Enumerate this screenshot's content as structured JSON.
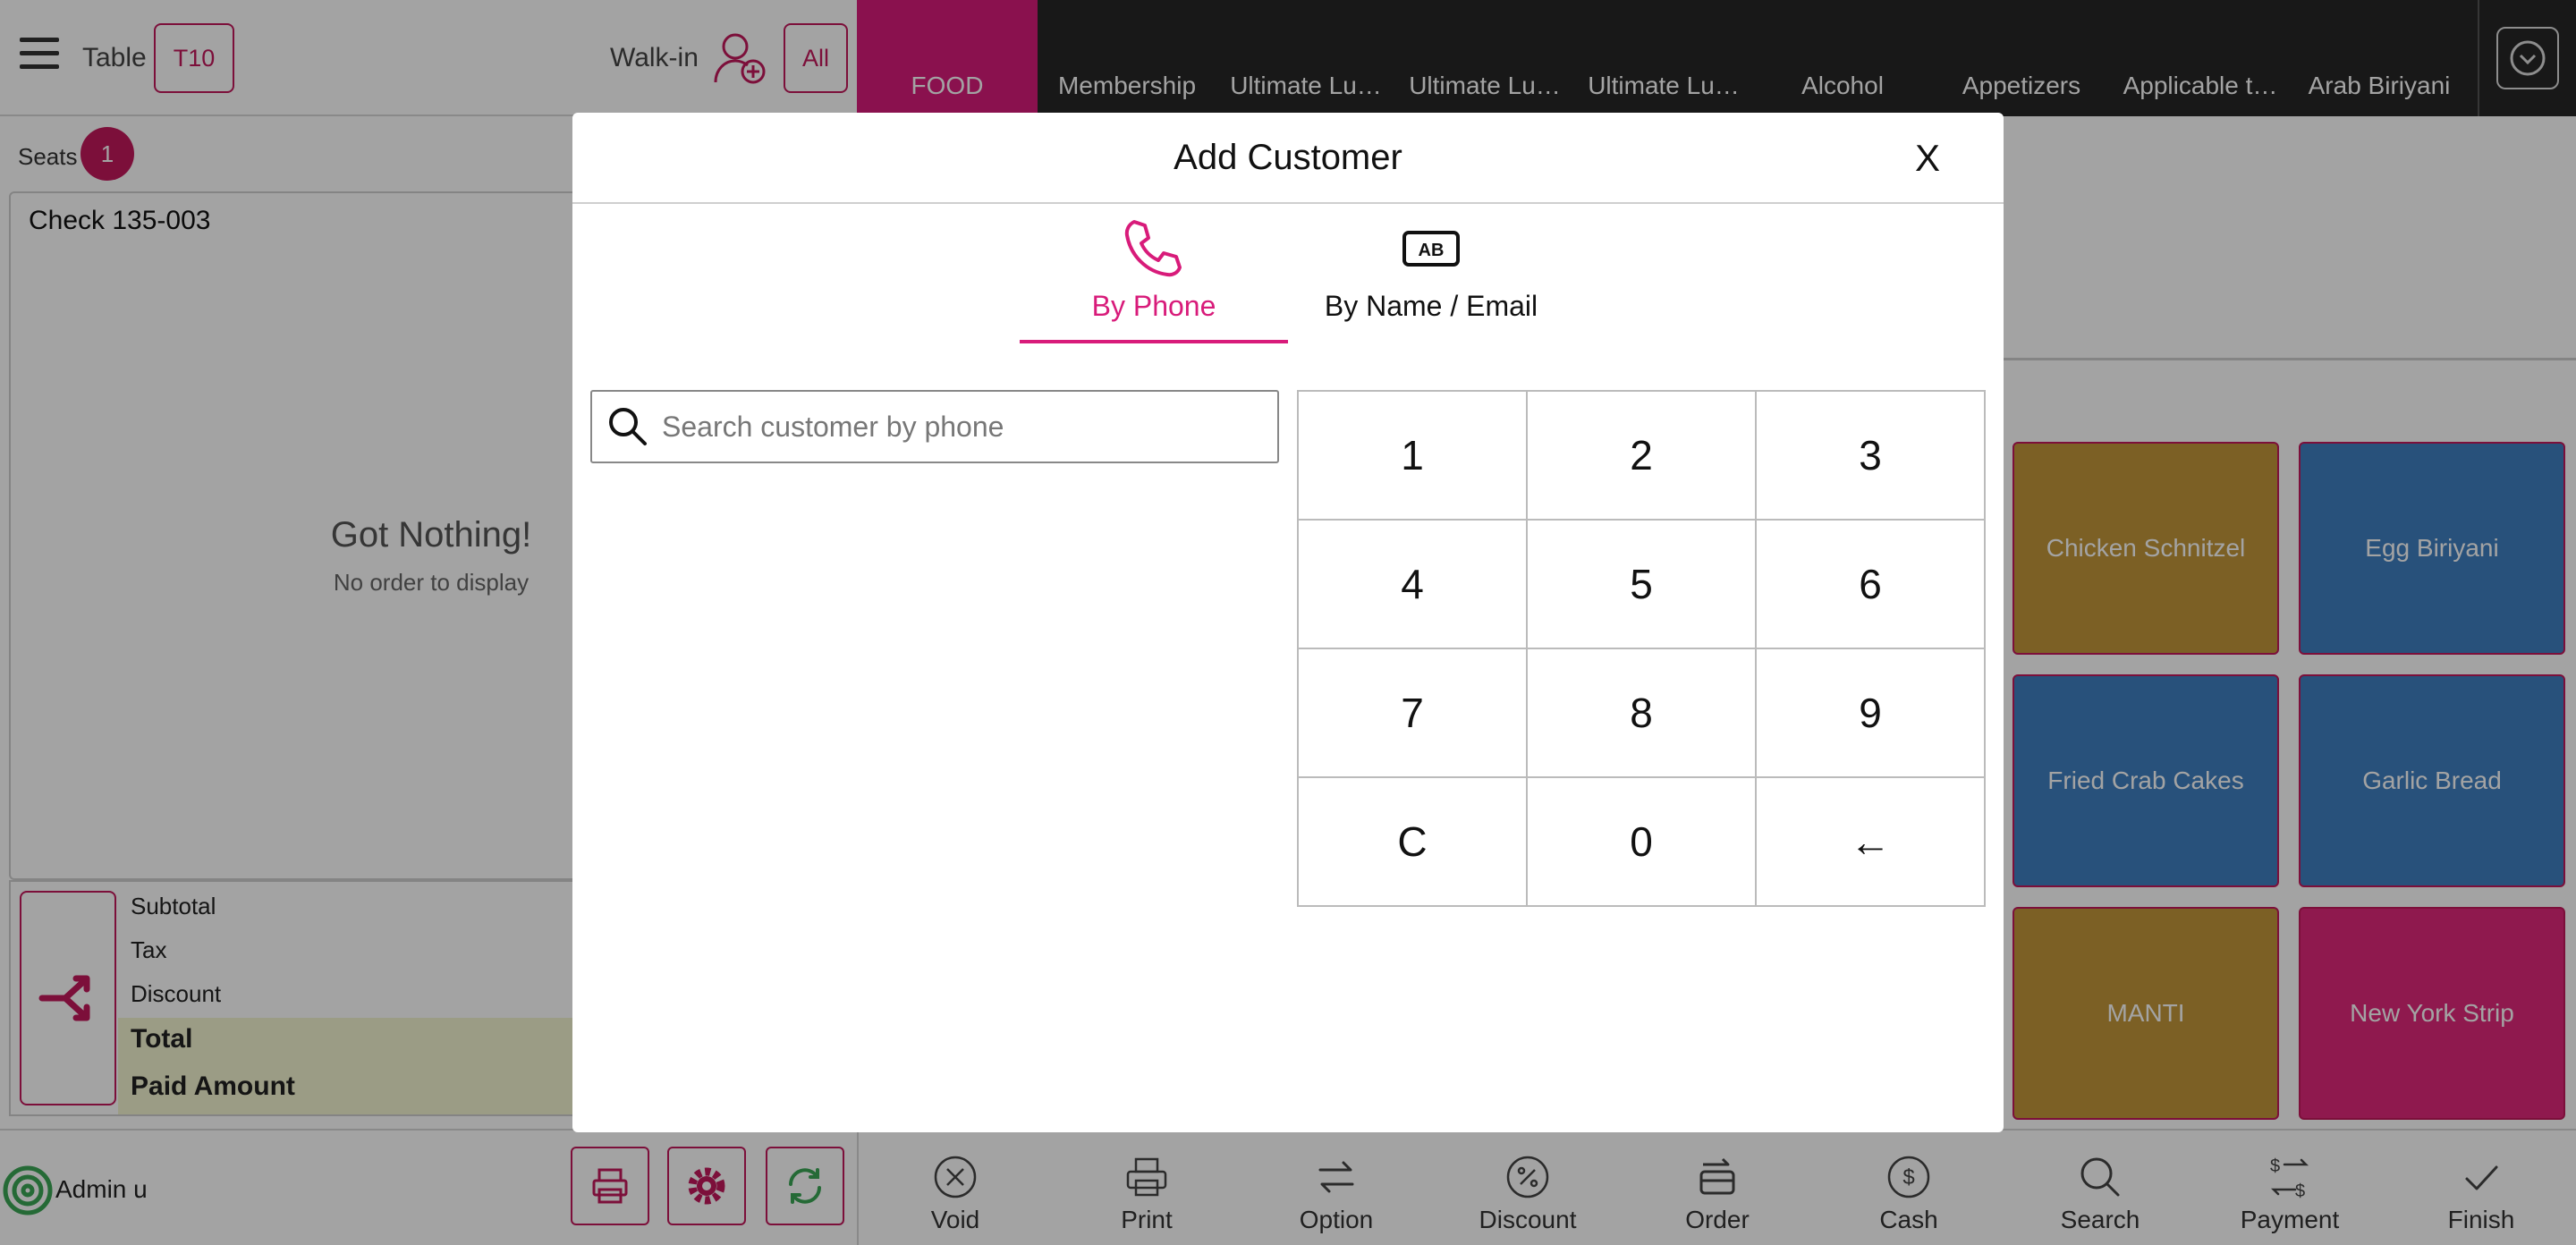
{
  "header": {
    "table_label": "Table",
    "table_value": "T10",
    "walkin_label": "Walk-in",
    "all_label": "All"
  },
  "categories": [
    "FOOD",
    "Membership",
    "Ultimate Lu…",
    "Ultimate Lu…",
    "Ultimate Lu…",
    "Alcohol",
    "Appetizers",
    "Applicable t…",
    "Arab Biriyani"
  ],
  "seats": {
    "label": "Seats",
    "count": "1"
  },
  "check": {
    "title": "Check 135-003",
    "empty_title": "Got Nothing!",
    "empty_subtitle": "No order to display"
  },
  "summary": {
    "subtotal": "Subtotal",
    "tax": "Tax",
    "discount": "Discount",
    "total": "Total",
    "paid": "Paid Amount"
  },
  "status": {
    "user": "Admin u"
  },
  "menu_items": [
    {
      "name": "Chicken Schnitzel",
      "color": "#c2973a"
    },
    {
      "name": "Egg Biriyani",
      "color": "#3f7fc1"
    },
    {
      "name": "Fried Crab Cakes",
      "color": "#3f7fc1"
    },
    {
      "name": "Garlic Bread",
      "color": "#3f7fc1"
    },
    {
      "name": "MANTI",
      "color": "#c2973a"
    },
    {
      "name": "New York Strip",
      "color": "#e0287a"
    }
  ],
  "actions": [
    "Void",
    "Print",
    "Option",
    "Discount",
    "Order",
    "Cash",
    "Search",
    "Payment",
    "Finish"
  ],
  "modal": {
    "title": "Add Customer",
    "close": "X",
    "tab_phone": "By Phone",
    "tab_name": "By Name / Email",
    "search_placeholder": "Search customer by phone",
    "keys": [
      "1",
      "2",
      "3",
      "4",
      "5",
      "6",
      "7",
      "8",
      "9",
      "C",
      "0",
      "←"
    ]
  },
  "colors": {
    "accent": "#d81b7a",
    "category_bar": "#262626"
  }
}
